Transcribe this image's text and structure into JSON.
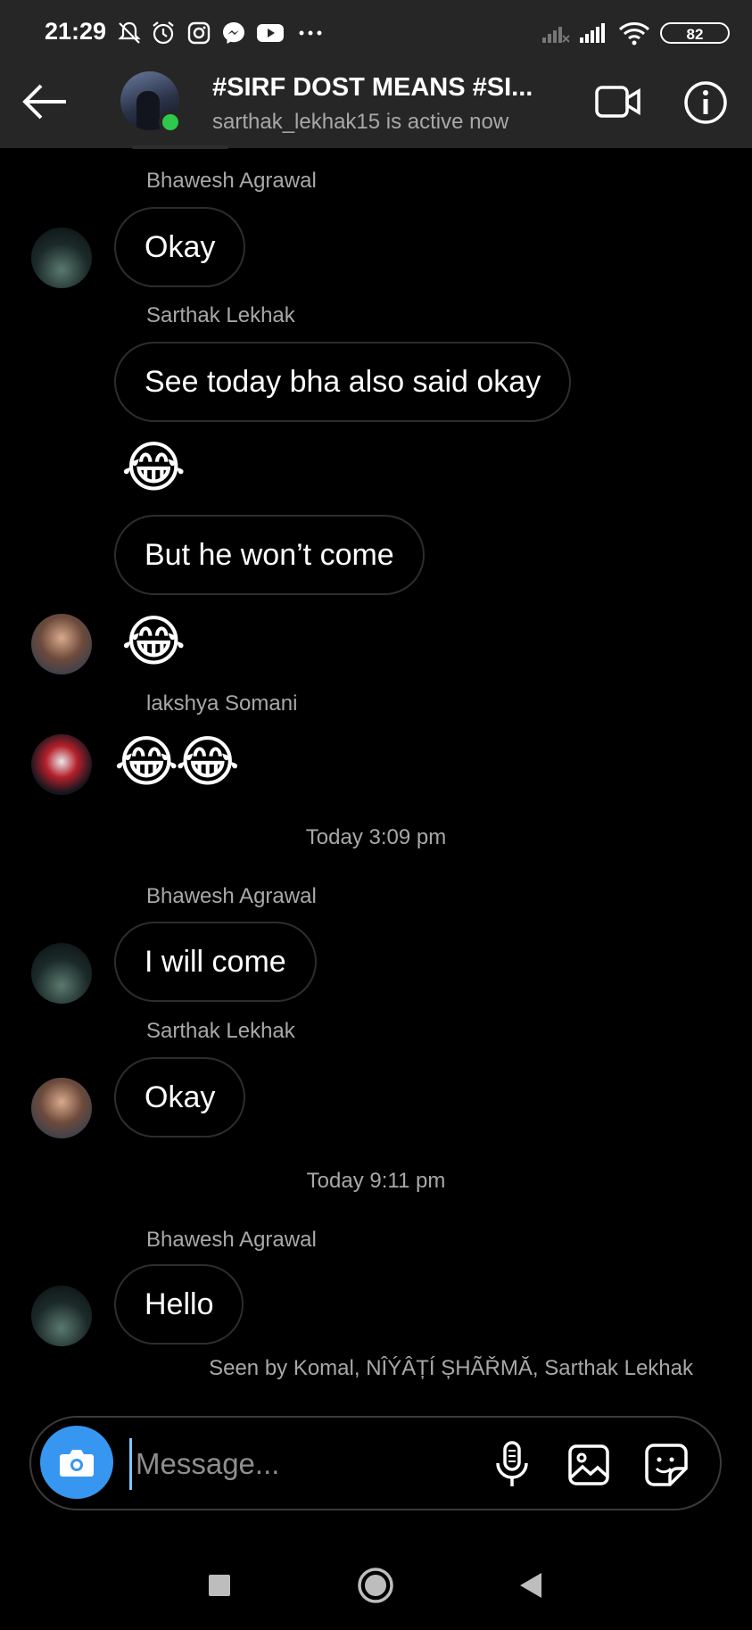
{
  "status_bar": {
    "time": "21:29",
    "icons": [
      "mute-bell-icon",
      "alarm-icon",
      "instagram-icon",
      "messenger-icon",
      "youtube-icon",
      "more-dots-icon"
    ],
    "right_icons": [
      "signal-off-icon",
      "signal-icon",
      "wifi-icon"
    ],
    "battery": "82"
  },
  "header": {
    "title": "#SIRF DOST MEANS #SI...",
    "active_status": "sarthak_lekhak15 is active now",
    "back_icon": "back-arrow-icon",
    "video_icon": "video-call-icon",
    "info_icon": "info-icon",
    "online_color": "#2ec84a"
  },
  "messages": {
    "m1_sender": "Bhawesh Agrawal",
    "m1_text": "Okay",
    "m2_sender": "Sarthak Lekhak",
    "m2_text": "See today bha also said okay",
    "m2_emoji": "😂",
    "m2_text2": "But he won’t come",
    "m2_emoji2": "😂",
    "m3_sender": "lakshya Somani",
    "m3_emoji": "😂😂",
    "ts1": "Today 3:09 pm",
    "m4_sender": "Bhawesh Agrawal",
    "m4_text": "I will come",
    "m5_sender": "Sarthak Lekhak",
    "m5_text": "Okay",
    "ts2": "Today 9:11 pm",
    "m6_sender": "Bhawesh Agrawal",
    "m6_text": "Hello",
    "seen_by": "Seen by Komal, NÎÝÂȚÍ ȘHÃŘMĂ, Sarthak Lekhak"
  },
  "composer": {
    "placeholder": "Message...",
    "icons": [
      "camera-icon",
      "microphone-icon",
      "gallery-icon",
      "sticker-icon"
    ],
    "camera_color": "#3797f0"
  },
  "nav": {
    "icons": [
      "recents-square-icon",
      "home-circle-icon",
      "back-triangle-icon"
    ]
  }
}
